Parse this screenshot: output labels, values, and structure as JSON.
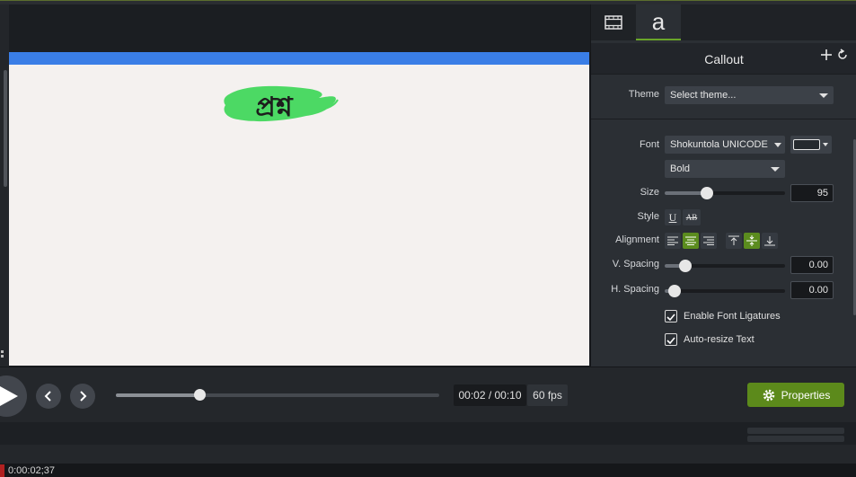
{
  "panel": {
    "tabs": [
      {
        "name": "visual-properties"
      },
      {
        "name": "text-properties",
        "label": "a"
      }
    ],
    "title": "Callout",
    "theme": {
      "label": "Theme",
      "value": "Select theme..."
    },
    "font": {
      "label": "Font",
      "value": "Shokuntola UNICODE",
      "weight": "Bold",
      "color": "#ffffff"
    },
    "size": {
      "label": "Size",
      "value": "95",
      "level": 0.35
    },
    "style": {
      "label": "Style",
      "underline": "U",
      "strike": "AB"
    },
    "alignment": {
      "label": "Alignment",
      "horizontal_selected": "center",
      "vertical_selected": "middle"
    },
    "v_spacing": {
      "label": "V. Spacing",
      "value": "0.00",
      "level": 0.17
    },
    "h_spacing": {
      "label": "H. Spacing",
      "value": "0.00",
      "level": 0.08
    },
    "ligatures": {
      "label": "Enable Font Ligatures",
      "checked": true
    },
    "autoresize": {
      "label": "Auto-resize Text",
      "checked": true
    }
  },
  "canvas": {
    "callout_text": "প্রশ্ন",
    "callout_color": "#4cd964",
    "accent_bar_color": "#3a7ee6"
  },
  "playback": {
    "timecode": "00:02 / 00:10",
    "fps": "60 fps",
    "progress": 0.2,
    "properties_label": "Properties"
  },
  "timeline": {
    "playhead_time": "0:00:02;37"
  }
}
